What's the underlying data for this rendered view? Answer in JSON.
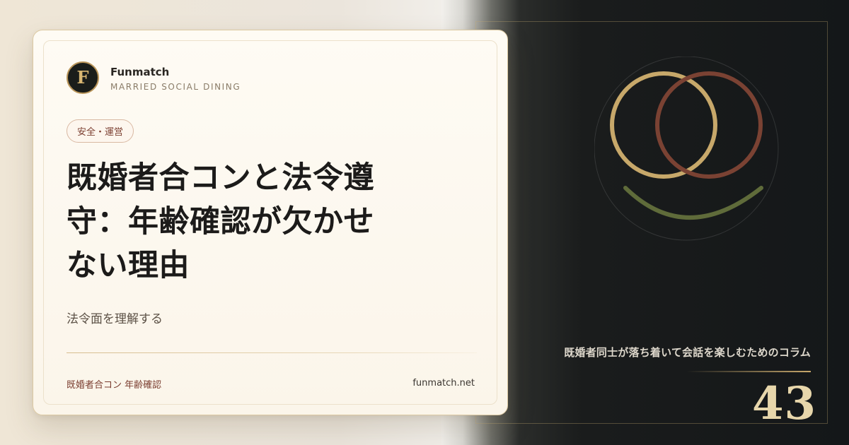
{
  "brand": {
    "logo_letter": "F",
    "name": "Funmatch",
    "tagline": "MARRIED SOCIAL DINING"
  },
  "category": "安全・運営",
  "headline": "既婚者合コンと法令遵守：年齢確認が欠かせない理由",
  "subtitle": "法令面を理解する",
  "footer": {
    "keywords": "既婚者合コン 年齢確認",
    "domain": "funmatch.net"
  },
  "series": {
    "description": "既婚者同士が落ち着いて会話を楽しむためのコラム",
    "number": "43"
  },
  "colors": {
    "gold": "#c9a96c",
    "ring_gold": "#c7a86a",
    "ring_red": "#7a4233",
    "smile_green": "#5f6b3a",
    "dark_bg": "#141719",
    "card_bg": "#fdf8ef",
    "accent_red": "#7a3d2f"
  },
  "emblem": {
    "icon_name": "interlocking-rings-smile-icon"
  }
}
